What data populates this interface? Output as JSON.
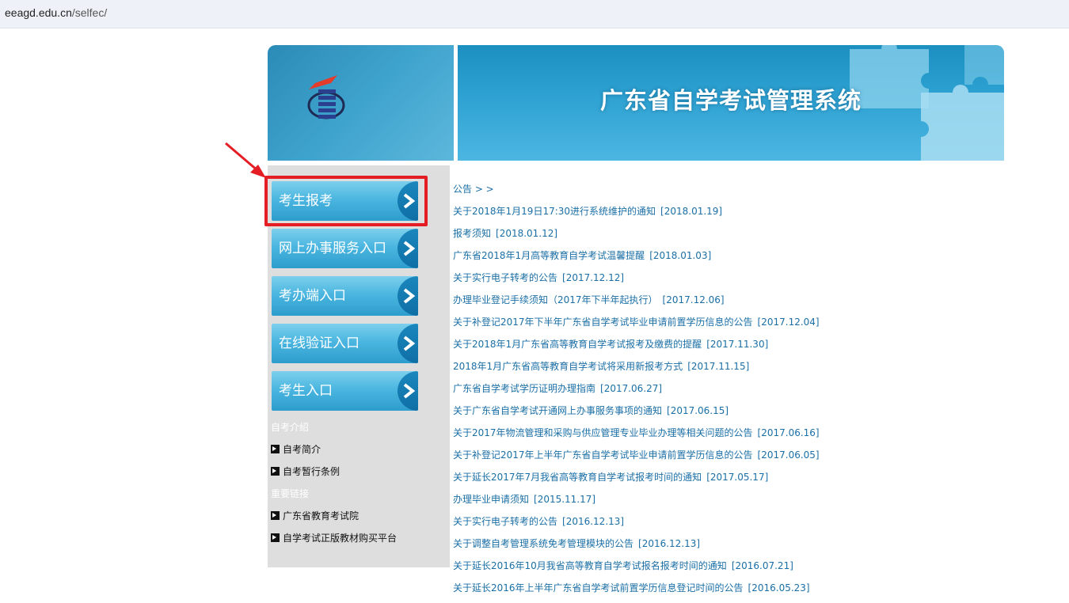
{
  "browser": {
    "url_host": "eeagd.edu.cn",
    "url_path": "/selfec/"
  },
  "banner": {
    "title": "广东省自学考试管理系统"
  },
  "menu": [
    {
      "label": "考生报考",
      "name": "menu-kaosheng-baokao",
      "highlighted": true
    },
    {
      "label": "网上办事服务入口",
      "name": "menu-online-service"
    },
    {
      "label": "考办端入口",
      "name": "menu-kaoban-entry"
    },
    {
      "label": "在线验证入口",
      "name": "menu-online-verify"
    },
    {
      "label": "考生入口",
      "name": "menu-student-entry"
    }
  ],
  "sidebar": {
    "section1": "自考介绍",
    "links1": [
      "自考简介",
      "自考暂行条例"
    ],
    "section2": "重要链接",
    "links2": [
      "广东省教育考试院",
      "自学考试正版教材购买平台"
    ]
  },
  "news": {
    "heading": "公告 > >",
    "items": [
      {
        "title": "关于2018年1月19日17:30进行系统维护的通知",
        "date": "[2018.01.19]"
      },
      {
        "title": "报考须知",
        "date": "[2018.01.12]"
      },
      {
        "title": "广东省2018年1月高等教育自学考试温馨提醒",
        "date": "[2018.01.03]"
      },
      {
        "title": "关于实行电子转考的公告",
        "date": "[2017.12.12]"
      },
      {
        "title": "办理毕业登记手续须知（2017年下半年起执行）",
        "date": "[2017.12.06]"
      },
      {
        "title": "关于补登记2017年下半年广东省自学考试毕业申请前置学历信息的公告",
        "date": "[2017.12.04]"
      },
      {
        "title": "关于2018年1月广东省高等教育自学考试报考及缴费的提醒",
        "date": "[2017.11.30]"
      },
      {
        "title": "2018年1月广东省高等教育自学考试将采用新报考方式",
        "date": "[2017.11.15]"
      },
      {
        "title": "广东省自学考试学历证明办理指南",
        "date": "[2017.06.27]"
      },
      {
        "title": "关于广东省自学考试开通网上办事服务事项的通知",
        "date": "[2017.06.15]"
      },
      {
        "title": "关于2017年物流管理和采购与供应管理专业毕业办理等相关问题的公告",
        "date": "[2017.06.16]"
      },
      {
        "title": "关于补登记2017年上半年广东省自学考试毕业申请前置学历信息的公告",
        "date": "[2017.06.05]"
      },
      {
        "title": "关于延长2017年7月我省高等教育自学考试报考时间的通知",
        "date": "[2017.05.17]"
      },
      {
        "title": "办理毕业申请须知",
        "date": "[2015.11.17]"
      },
      {
        "title": "关于实行电子转考的公告",
        "date": "[2016.12.13]"
      },
      {
        "title": "关于调整自考管理系统免考管理模块的公告",
        "date": "[2016.12.13]"
      },
      {
        "title": "关于延长2016年10月我省高等教育自学考试报名报考时间的通知",
        "date": "[2016.07.21]"
      },
      {
        "title": "关于延长2016年上半年广东省自学考试前置学历信息登记时间的公告",
        "date": "[2016.05.23]"
      }
    ]
  },
  "colors": {
    "link": "#1b6fa6",
    "highlight": "#e51e26",
    "sidebar_bg": "#dedede"
  },
  "annotation": {
    "arrow_color": "#e51e26"
  }
}
